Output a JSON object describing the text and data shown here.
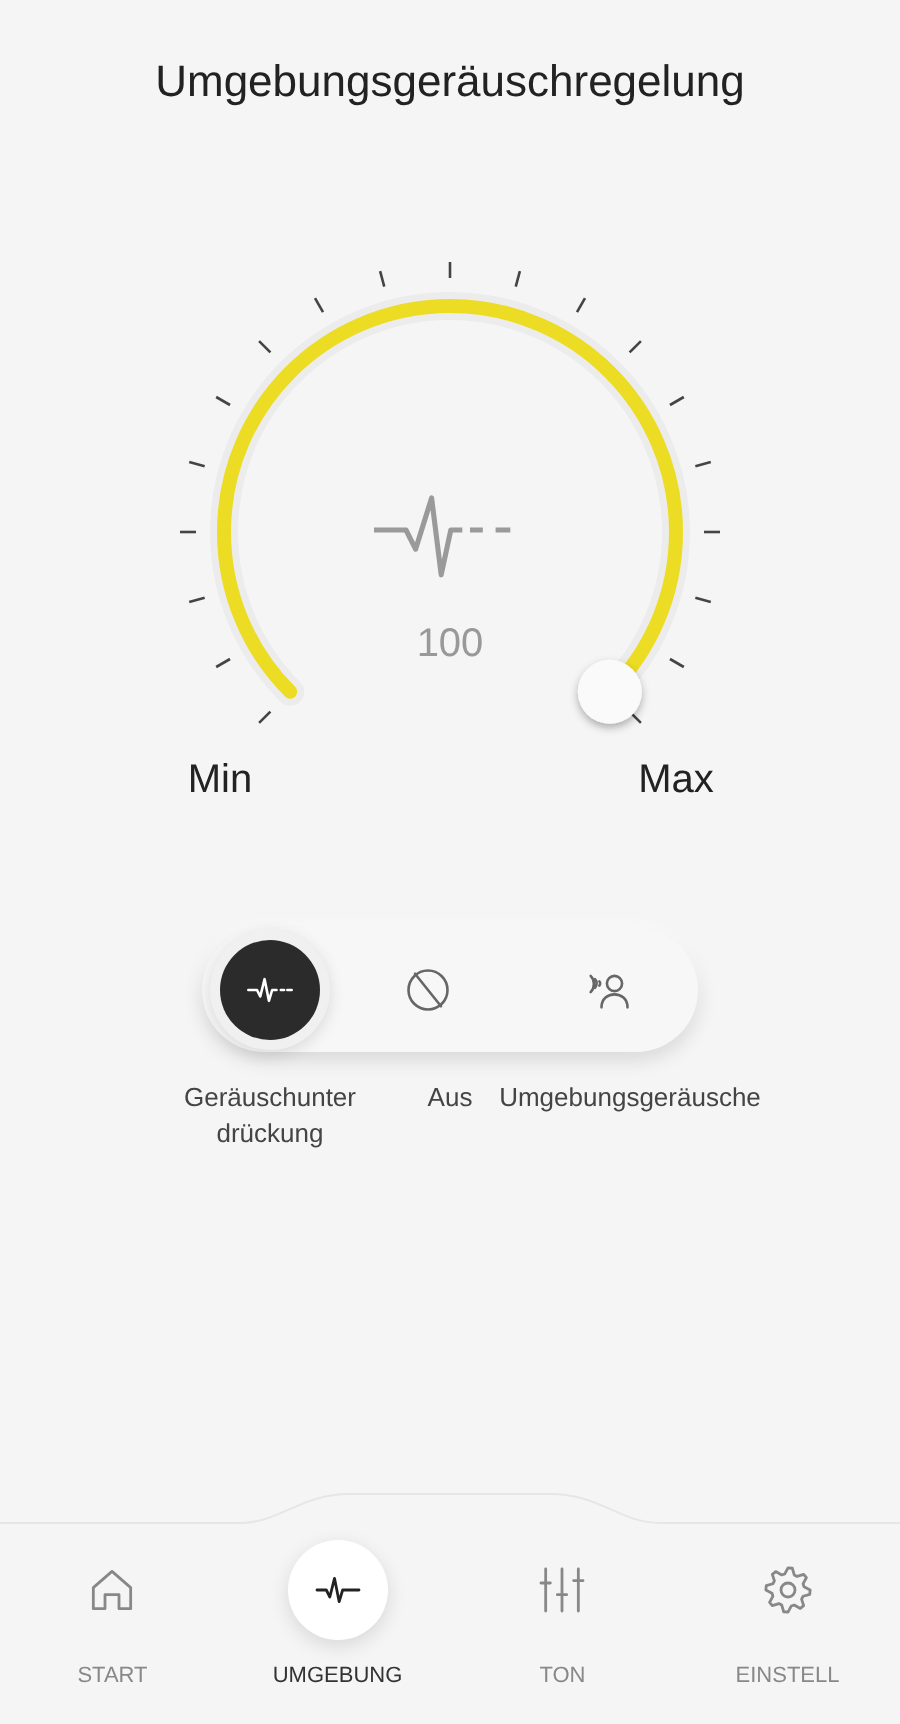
{
  "title": "Umgebungsgeräuschregelung",
  "dial": {
    "value": "100",
    "min_label": "Min",
    "max_label": "Max"
  },
  "modes": [
    {
      "label": "Geräuschunter\ndrückung",
      "selected": true
    },
    {
      "label": "Aus",
      "selected": false
    },
    {
      "label": "Umgebungsgeräusche",
      "selected": false
    }
  ],
  "nav": [
    {
      "label": "START",
      "selected": false
    },
    {
      "label": "UMGEBUNG",
      "selected": true
    },
    {
      "label": "TON",
      "selected": false
    },
    {
      "label": "EINSTELL",
      "selected": false
    }
  ]
}
